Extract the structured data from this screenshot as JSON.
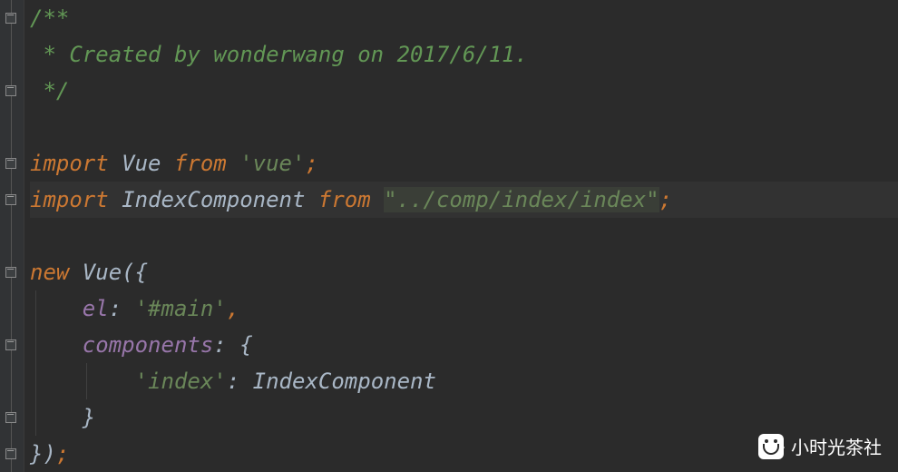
{
  "colors": {
    "background": "#2b2b2b",
    "gutter": "#313335",
    "comment": "#808080",
    "doc_comment": "#629755",
    "keyword": "#cc7832",
    "identifier": "#a9b7c6",
    "string": "#6a8759",
    "property": "#9876aa"
  },
  "code": {
    "lines": [
      {
        "indent": 0,
        "tokens": [
          {
            "t": "doc",
            "v": "/**"
          }
        ]
      },
      {
        "indent": 0,
        "tokens": [
          {
            "t": "doc",
            "v": " * Created by wonderwang on 2017/6/11."
          }
        ]
      },
      {
        "indent": 0,
        "tokens": [
          {
            "t": "doc",
            "v": " */"
          }
        ]
      },
      {
        "indent": 0,
        "tokens": []
      },
      {
        "indent": 0,
        "tokens": [
          {
            "t": "kw",
            "v": "import "
          },
          {
            "t": "id",
            "v": "Vue "
          },
          {
            "t": "kw",
            "v": "from "
          },
          {
            "t": "str",
            "v": "'vue'"
          },
          {
            "t": "pu",
            "v": ";"
          }
        ]
      },
      {
        "indent": 0,
        "highlight": true,
        "tokens": [
          {
            "t": "kw",
            "v": "import "
          },
          {
            "t": "id",
            "v": "IndexComponent "
          },
          {
            "t": "kw",
            "v": "from "
          },
          {
            "t": "strhl",
            "v": "\"../comp/index/index\""
          },
          {
            "t": "pu",
            "v": ";"
          }
        ]
      },
      {
        "indent": 0,
        "tokens": []
      },
      {
        "indent": 0,
        "tokens": [
          {
            "t": "kw",
            "v": "new "
          },
          {
            "t": "id",
            "v": "Vue({"
          }
        ]
      },
      {
        "indent": 1,
        "tokens": [
          {
            "t": "prop",
            "v": "el"
          },
          {
            "t": "id",
            "v": ": "
          },
          {
            "t": "str",
            "v": "'#main'"
          },
          {
            "t": "pu",
            "v": ","
          }
        ]
      },
      {
        "indent": 1,
        "tokens": [
          {
            "t": "prop",
            "v": "components"
          },
          {
            "t": "id",
            "v": ": {"
          }
        ]
      },
      {
        "indent": 2,
        "tokens": [
          {
            "t": "str",
            "v": "'index'"
          },
          {
            "t": "id",
            "v": ": IndexComponent"
          }
        ]
      },
      {
        "indent": 1,
        "tokens": [
          {
            "t": "id",
            "v": "}"
          }
        ]
      },
      {
        "indent": 0,
        "tokens": [
          {
            "t": "id",
            "v": "})"
          },
          {
            "t": "pu",
            "v": ";"
          }
        ]
      }
    ]
  },
  "fold_markers_at_lines": [
    0,
    2,
    4,
    5,
    7,
    9,
    11,
    12
  ],
  "watermark": {
    "icon": "wechat-chat-icon",
    "text": "小时光茶社"
  }
}
